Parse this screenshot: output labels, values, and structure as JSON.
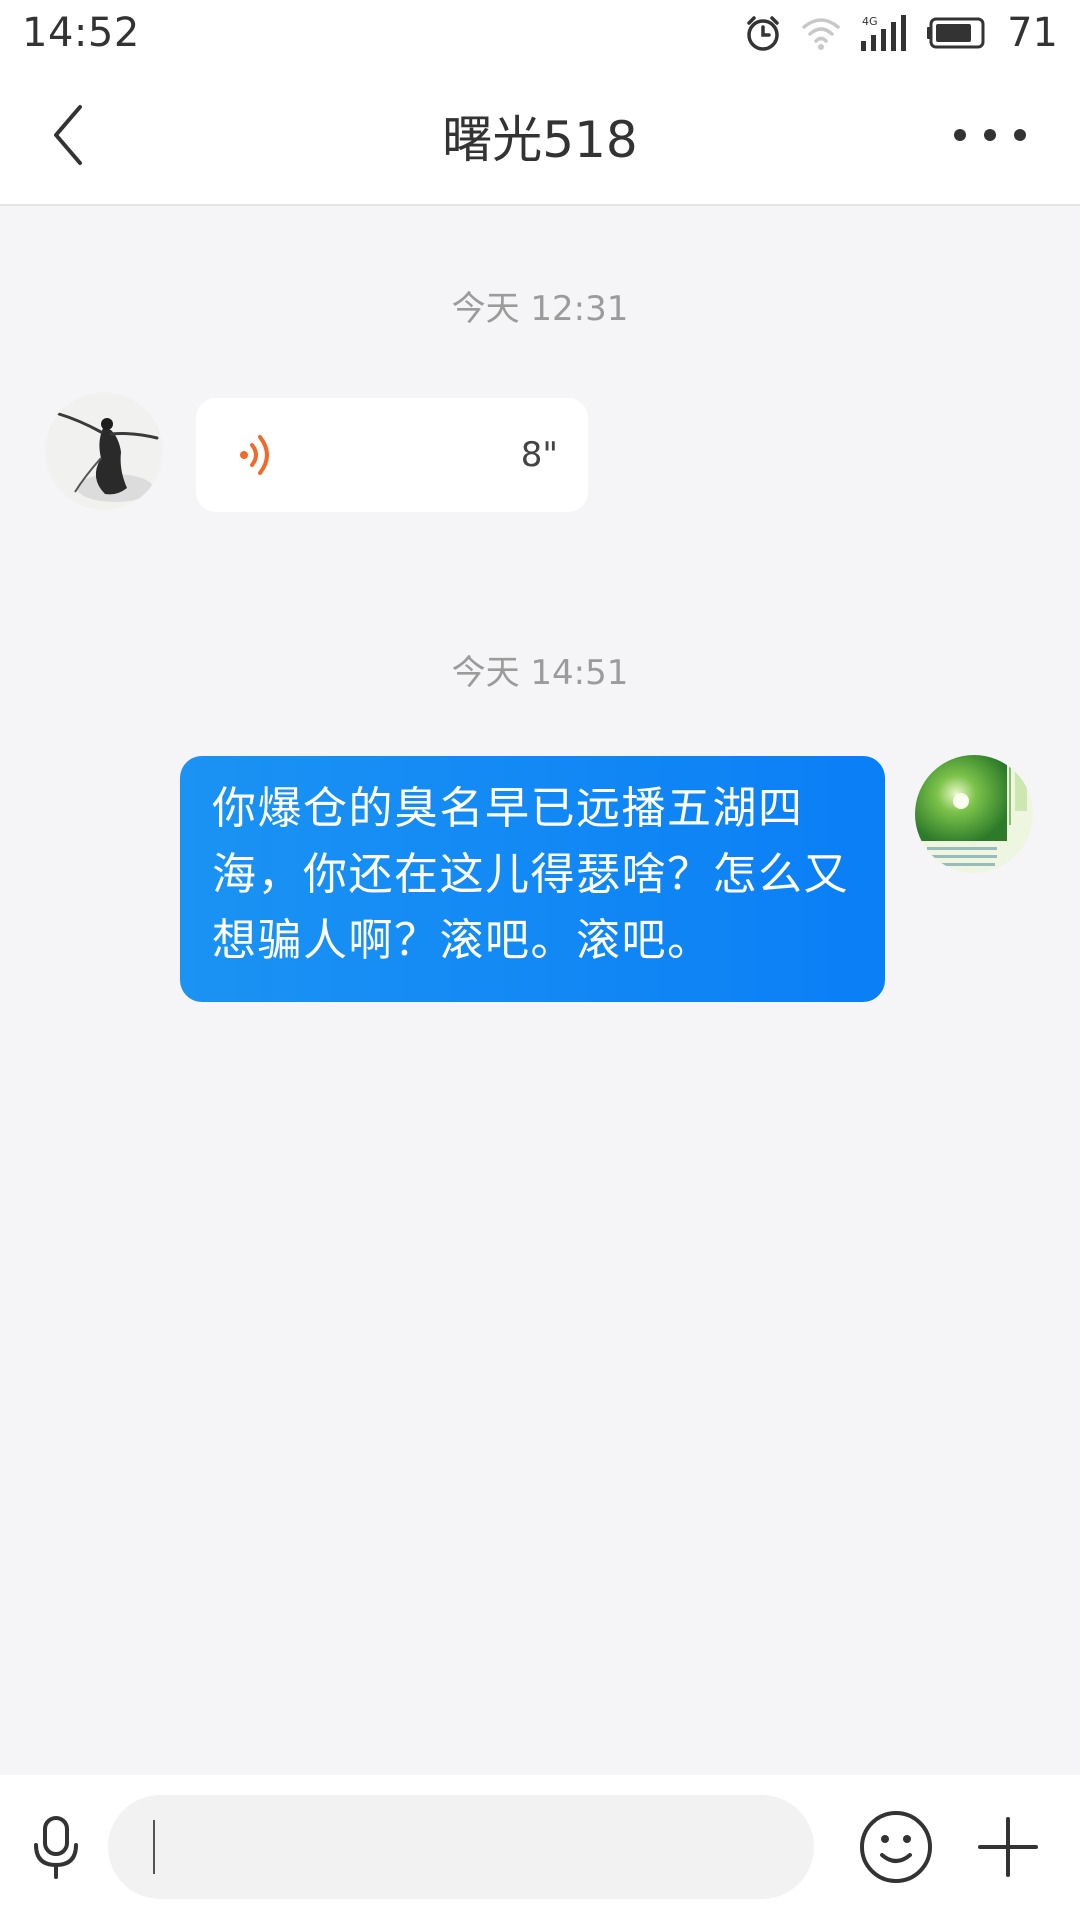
{
  "status_bar": {
    "time": "14:52",
    "network": "4G",
    "battery": "71",
    "icons": [
      "alarm-icon",
      "wifi-icon",
      "signal-icon",
      "battery-icon"
    ]
  },
  "header": {
    "title": "曙光518",
    "back_icon": "chevron-left-icon",
    "more_icon": "more-dots-icon"
  },
  "messages": [
    {
      "timestamp": "今天 12:31",
      "direction": "incoming",
      "type": "voice",
      "duration": "8\"",
      "icon": "voice-wave-icon"
    },
    {
      "timestamp": "今天 14:51",
      "direction": "outgoing",
      "type": "text",
      "text": "你爆仓的臭名早已远播五湖四海，你还在这儿得瑟啥？怎么又想骗人啊？滚吧。滚吧。"
    }
  ],
  "input_bar": {
    "value": "",
    "icons": [
      "mic-icon",
      "emoji-icon",
      "plus-icon"
    ]
  },
  "colors": {
    "accent": "#0a7ff6",
    "voice_icon": "#f26a2a",
    "background": "#f5f5f7"
  }
}
